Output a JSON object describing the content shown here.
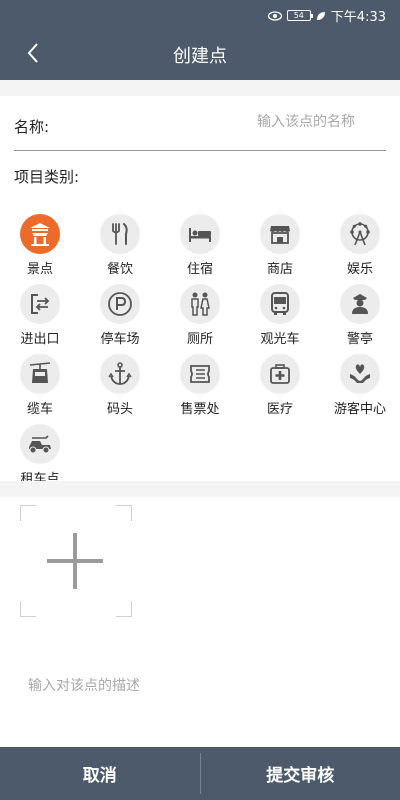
{
  "status_bar": {
    "time": "下午4:33",
    "battery": "54"
  },
  "header": {
    "title": "创建点"
  },
  "form": {
    "name_label": "名称:",
    "name_placeholder": "输入该点的名称",
    "category_label": "项目类别:",
    "description_placeholder": "输入对该点的描述"
  },
  "categories": [
    {
      "label": "景点",
      "icon": "pavilion-icon",
      "selected": true
    },
    {
      "label": "餐饮",
      "icon": "fork-knife-icon",
      "selected": false
    },
    {
      "label": "住宿",
      "icon": "bed-icon",
      "selected": false
    },
    {
      "label": "商店",
      "icon": "shop-icon",
      "selected": false
    },
    {
      "label": "娱乐",
      "icon": "ferris-wheel-icon",
      "selected": false
    },
    {
      "label": "进出口",
      "icon": "entrance-exit-icon",
      "selected": false
    },
    {
      "label": "停车场",
      "icon": "parking-icon",
      "selected": false
    },
    {
      "label": "厕所",
      "icon": "toilet-icon",
      "selected": false
    },
    {
      "label": "观光车",
      "icon": "bus-icon",
      "selected": false
    },
    {
      "label": "警亭",
      "icon": "police-icon",
      "selected": false
    },
    {
      "label": "缆车",
      "icon": "cable-car-icon",
      "selected": false
    },
    {
      "label": "码头",
      "icon": "anchor-icon",
      "selected": false
    },
    {
      "label": "售票处",
      "icon": "ticket-icon",
      "selected": false
    },
    {
      "label": "医疗",
      "icon": "medical-kit-icon",
      "selected": false
    },
    {
      "label": "游客中心",
      "icon": "visitor-center-icon",
      "selected": false
    },
    {
      "label": "租车点",
      "icon": "rental-cart-icon",
      "selected": false
    }
  ],
  "buttons": {
    "cancel": "取消",
    "submit": "提交审核"
  },
  "colors": {
    "header": "#4c5a6c",
    "accent": "#ec6a2a",
    "icon_bg": "#ececec",
    "icon_fg": "#555555"
  }
}
